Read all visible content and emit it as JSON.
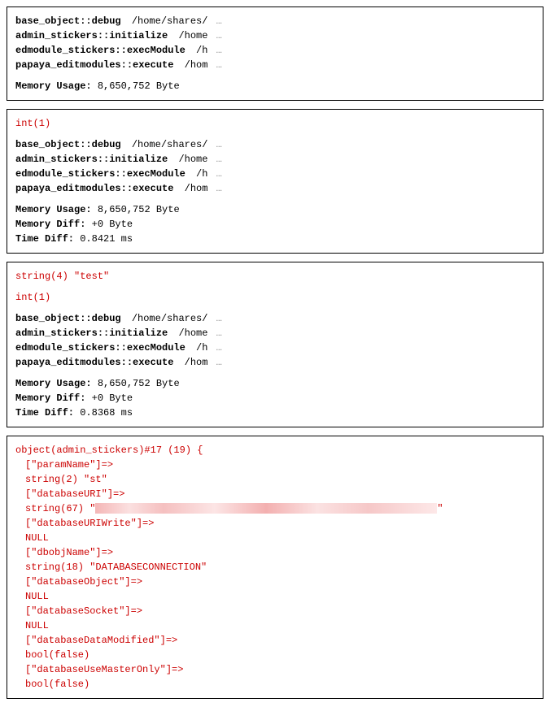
{
  "box1": {
    "traces": [
      {
        "func": "base_object::debug",
        "path": "/home/shares/",
        "ell": "…"
      },
      {
        "func": "admin_stickers::initialize",
        "path": "/home",
        "ell": "…"
      },
      {
        "func": "edmodule_stickers::execModule",
        "path": "/h",
        "ell": "…"
      },
      {
        "func": "papaya_editmodules::execute",
        "path": "/hom",
        "ell": "…"
      }
    ],
    "memory_usage_label": "Memory Usage:",
    "memory_usage_value": "8,650,752 Byte"
  },
  "box2": {
    "dump1": "int(1)",
    "traces": [
      {
        "func": "base_object::debug",
        "path": "/home/shares/",
        "ell": "…"
      },
      {
        "func": "admin_stickers::initialize",
        "path": "/home",
        "ell": "…"
      },
      {
        "func": "edmodule_stickers::execModule",
        "path": "/h",
        "ell": "…"
      },
      {
        "func": "papaya_editmodules::execute",
        "path": "/hom",
        "ell": "…"
      }
    ],
    "memory_usage_label": "Memory Usage:",
    "memory_usage_value": "8,650,752 Byte",
    "memory_diff_label": "Memory Diff:",
    "memory_diff_value": "+0 Byte",
    "time_diff_label": "Time Diff:",
    "time_diff_value": "0.8421 ms"
  },
  "box3": {
    "dump1": "string(4) \"test\"",
    "dump2": "int(1)",
    "traces": [
      {
        "func": "base_object::debug",
        "path": "/home/shares/",
        "ell": "…"
      },
      {
        "func": "admin_stickers::initialize",
        "path": "/home",
        "ell": "…"
      },
      {
        "func": "edmodule_stickers::execModule",
        "path": "/h",
        "ell": "…"
      },
      {
        "func": "papaya_editmodules::execute",
        "path": "/hom",
        "ell": "…"
      }
    ],
    "memory_usage_label": "Memory Usage:",
    "memory_usage_value": "8,650,752 Byte",
    "memory_diff_label": "Memory Diff:",
    "memory_diff_value": "+0 Byte",
    "time_diff_label": "Time Diff:",
    "time_diff_value": "0.8368 ms"
  },
  "box4": {
    "header": "object(admin_stickers)#17 (19) {",
    "lines": [
      "[\"paramName\"]=>",
      "string(2) \"st\"",
      "[\"databaseURI\"]=>",
      "__CENSORED__",
      "[\"databaseURIWrite\"]=>",
      "NULL",
      "[\"dbobjName\"]=>",
      "string(18) \"DATABASECONNECTION\"",
      "[\"databaseObject\"]=>",
      "NULL",
      "[\"databaseSocket\"]=>",
      "NULL",
      "[\"databaseDataModified\"]=>",
      "bool(false)",
      "[\"databaseUseMasterOnly\"]=>",
      "bool(false)"
    ],
    "censored_prefix": "string(67) \"",
    "censored_suffix": "\""
  }
}
